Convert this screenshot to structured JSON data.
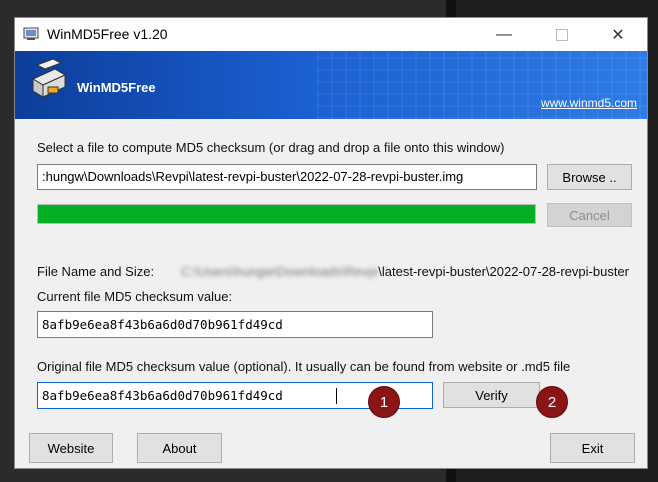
{
  "window": {
    "title": "WinMD5Free v1.20",
    "controls": {
      "minimize": "—",
      "maximize": "",
      "close": "✕"
    }
  },
  "banner": {
    "brand": "WinMD5Free",
    "website": "www.winmd5.com"
  },
  "file_select": {
    "instruction": "Select a file to compute MD5 checksum (or drag and drop a file onto this window)",
    "path_value": ":hungw\\Downloads\\Revpi\\latest-revpi-buster\\2022-07-28-revpi-buster.img",
    "browse_button": "Browse ..",
    "cancel_button": "Cancel",
    "progress_percent": 100
  },
  "file_info": {
    "name_label": "File Name and Size:",
    "name_redacted": "C:\\Users\\hungw\\Downloads\\Revpi",
    "name_visible": "\\latest-revpi-buster\\2022-07-28-revpi-buster"
  },
  "current_md5": {
    "label": "Current file MD5 checksum value:",
    "value": "8afb9e6ea8f43b6a6d0d70b961fd49cd"
  },
  "original_md5": {
    "label": "Original file MD5 checksum value (optional). It usually can be found from website or .md5 file",
    "value": "8afb9e6ea8f43b6a6d0d70b961fd49cd",
    "verify_button": "Verify"
  },
  "footer": {
    "website_button": "Website",
    "about_button": "About",
    "exit_button": "Exit"
  },
  "annotations": {
    "badge_1": "1",
    "badge_2": "2"
  },
  "colors": {
    "progress": "#06b025",
    "banner": "#1a5fd0",
    "badge": "#8b1414"
  }
}
